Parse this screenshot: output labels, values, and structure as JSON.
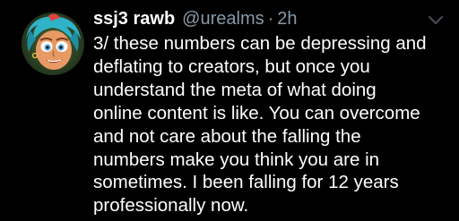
{
  "tweet": {
    "display_name": "ssj3 rawb",
    "handle": "@urealms",
    "separator": "·",
    "timestamp": "2h",
    "text_lines": [
      "3/ these numbers can be depressing and",
      "deflating to creators, but once you",
      "understand the meta of what doing",
      "online content is like. You can overcome",
      "and not care about the falling the",
      "numbers make you think you are in",
      "sometimes. I been falling for 12 years",
      "professionally now."
    ]
  },
  "icons": {
    "avatar": "avatar-image",
    "menu": "chevron-down-icon"
  },
  "colors": {
    "background": "#000000",
    "text": "#ffffff",
    "muted": "#8899a6"
  }
}
